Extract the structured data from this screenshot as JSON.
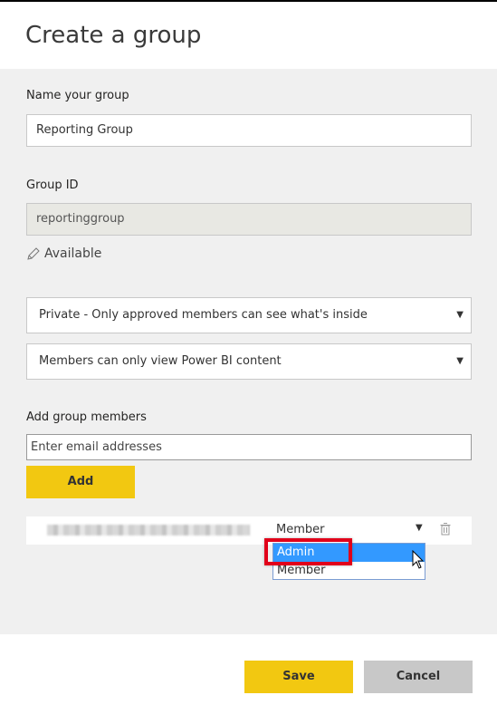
{
  "dialog": {
    "title": "Create a group"
  },
  "name_section": {
    "label": "Name your group",
    "value": "Reporting Group"
  },
  "group_id_section": {
    "label": "Group ID",
    "value": "reportinggroup",
    "status": "Available",
    "status_icon": "pencil-icon"
  },
  "privacy_select": {
    "value": "Private - Only approved members can see what's inside"
  },
  "permission_select": {
    "value": "Members can only view Power BI content"
  },
  "members_section": {
    "label": "Add group members",
    "input_placeholder": "Enter email addresses",
    "add_label": "Add"
  },
  "member_row": {
    "role": "Member",
    "delete_icon": "trash-icon"
  },
  "role_dropdown": {
    "options": [
      "Admin",
      "Member"
    ],
    "highlighted": "Admin"
  },
  "footer": {
    "save_label": "Save",
    "cancel_label": "Cancel"
  },
  "colors": {
    "accent": "#f2c811",
    "highlight": "#e1001a",
    "selection": "#3399ff"
  }
}
